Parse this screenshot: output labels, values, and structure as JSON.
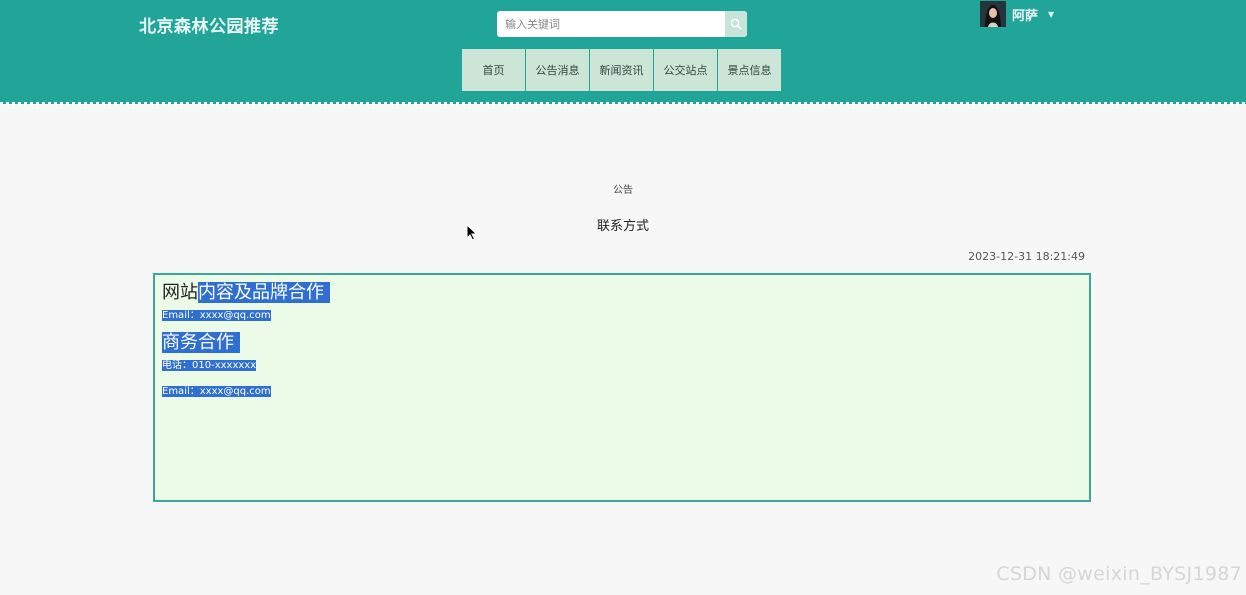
{
  "header": {
    "site_title": "北京森林公园推荐",
    "search_placeholder": "输入关键词",
    "user_name": "阿萨",
    "caret": "▼"
  },
  "nav": {
    "items": [
      {
        "label": "首页"
      },
      {
        "label": "公告消息"
      },
      {
        "label": "新闻资讯"
      },
      {
        "label": "公交站点"
      },
      {
        "label": "景点信息"
      }
    ]
  },
  "article": {
    "section": "公告",
    "title": "联系方式",
    "time": "2023-12-31 18:21:49",
    "heading1_plain": "网站",
    "heading1_highlight": "内容及品牌合作",
    "email1": "Email：xxxx@qq.com",
    "heading2": "商务合作",
    "phone": "电话：010-xxxxxxx",
    "email2": "Email：xxxx@qq.com"
  },
  "watermark": "CSDN @weixin_BYSJ1987",
  "colors": {
    "header_bg": "#20a598",
    "nav_bg": "#cde5d6",
    "content_bg": "#ebfbe8",
    "content_border": "#3aa69a",
    "selection": "#2f6fd1"
  },
  "icons": {
    "search": "search-icon",
    "avatar": "avatar",
    "caret": "chevron-down-icon",
    "cursor": "mouse-cursor-icon"
  }
}
